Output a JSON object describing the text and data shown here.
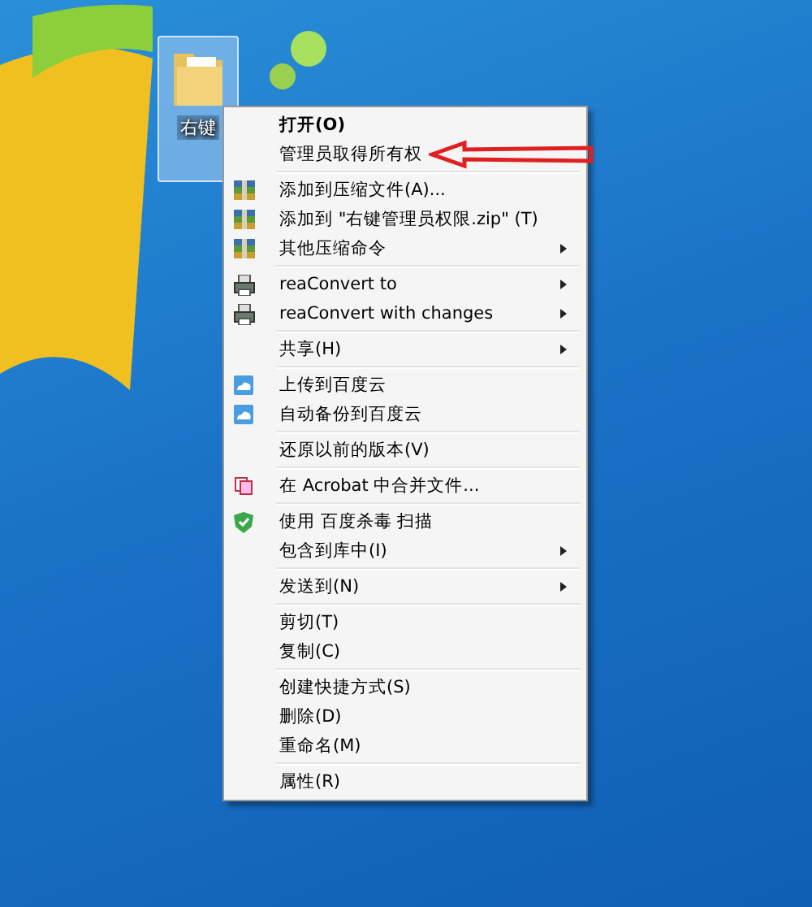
{
  "desktop_icon": {
    "label": "右键",
    "selected": true
  },
  "context_menu": {
    "groups": [
      [
        {
          "label": "打开(O)",
          "default": true,
          "submenu": false
        },
        {
          "label": "管理员取得所有权",
          "default": false,
          "submenu": false,
          "arrow_marked": true
        }
      ],
      [
        {
          "label": "添加到压缩文件(A)...",
          "kind": "archive",
          "default": false,
          "submenu": false
        },
        {
          "label": "添加到 \"右键管理员权限.zip\" (T)",
          "kind": "archive",
          "default": false,
          "submenu": false
        },
        {
          "label": "其他压缩命令",
          "kind": "archive",
          "default": false,
          "submenu": true
        }
      ],
      [
        {
          "label": "reaConvert to",
          "kind": "converter",
          "default": false,
          "submenu": true
        },
        {
          "label": "reaConvert with changes",
          "kind": "converter",
          "default": false,
          "submenu": true
        }
      ],
      [
        {
          "label": "共享(H)",
          "default": false,
          "submenu": true
        }
      ],
      [
        {
          "label": "上传到百度云",
          "kind": "cloud",
          "default": false,
          "submenu": false
        },
        {
          "label": "自动备份到百度云",
          "kind": "cloud",
          "default": false,
          "submenu": false
        }
      ],
      [
        {
          "label": "还原以前的版本(V)",
          "default": false,
          "submenu": false
        }
      ],
      [
        {
          "label": "在 Acrobat 中合并文件...",
          "kind": "acrobat",
          "default": false,
          "submenu": false
        }
      ],
      [
        {
          "label": "使用 百度杀毒 扫描",
          "kind": "shield",
          "default": false,
          "submenu": false
        },
        {
          "label": "包含到库中(I)",
          "default": false,
          "submenu": true
        }
      ],
      [
        {
          "label": "发送到(N)",
          "default": false,
          "submenu": true
        }
      ],
      [
        {
          "label": "剪切(T)",
          "default": false,
          "submenu": false
        },
        {
          "label": "复制(C)",
          "default": false,
          "submenu": false
        }
      ],
      [
        {
          "label": "创建快捷方式(S)",
          "default": false,
          "submenu": false
        },
        {
          "label": "删除(D)",
          "default": false,
          "submenu": false
        },
        {
          "label": "重命名(M)",
          "default": false,
          "submenu": false
        }
      ],
      [
        {
          "label": "属性(R)",
          "default": false,
          "submenu": false
        }
      ]
    ]
  }
}
